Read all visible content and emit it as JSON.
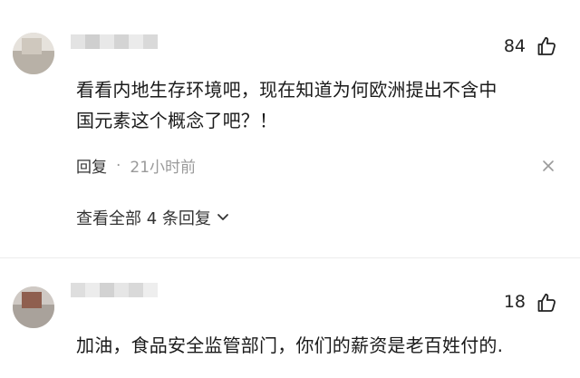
{
  "comments": [
    {
      "like_count": "84",
      "text_lines": [
        "看看内地生存环境吧，现在知道为何欧洲提出不含中",
        "国元素这个概念了吧？！"
      ],
      "reply_label": "回复",
      "separator": "·",
      "time": "21小时前",
      "view_replies": "查看全部 4 条回复"
    },
    {
      "like_count": "18",
      "text_lines": [
        "加油，食品安全监管部门，你们的薪资是老百姓付的."
      ]
    }
  ],
  "icons": {
    "like": "thumbs-up-icon",
    "close": "close-icon",
    "expand": "chevron-down-icon"
  },
  "colors": {
    "text": "#1a1a1a",
    "meta": "#9a9a9a"
  }
}
